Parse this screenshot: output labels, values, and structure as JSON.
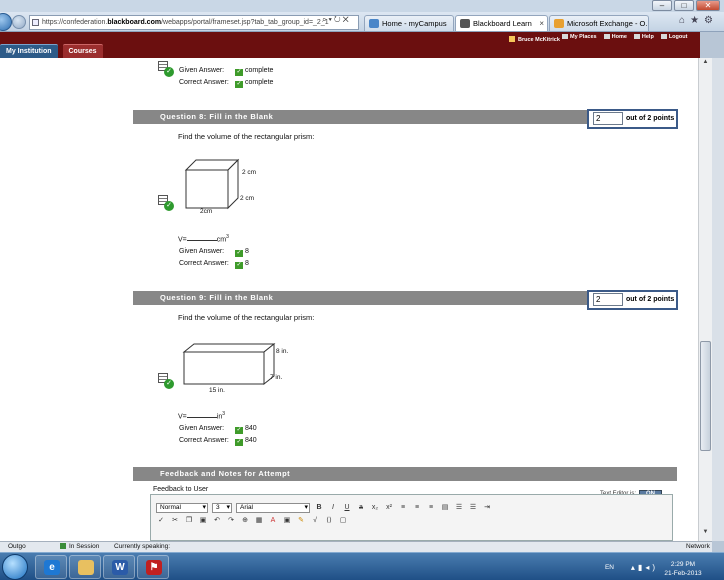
{
  "browser": {
    "url_prefix": "https://confederation.",
    "url_domain": "blackboard.com",
    "url_rest": "/webapps/portal/frameset.jsp?tab_tab_group_id=_2_1",
    "tabs": [
      {
        "label": "Home - myCampus",
        "color": "#4a86c8"
      },
      {
        "label": "Blackboard Learn",
        "color": "#555555"
      },
      {
        "label": "Microsoft Exchange - O...",
        "color": "#e8a030"
      }
    ]
  },
  "bb": {
    "user": "Bruce McKitrick",
    "links": [
      "My Places",
      "Home",
      "Help",
      "Logout"
    ],
    "tabs": [
      "My Institution",
      "Courses"
    ]
  },
  "prev": {
    "given_label": "Given Answer:",
    "given_value": "complete",
    "correct_label": "Correct Answer:",
    "correct_value": "complete"
  },
  "q8": {
    "header": "Question 8:   Fill in the Blank",
    "points_value": "2",
    "points_suffix": "out of 2 points",
    "prompt": "Find the volume of the rectangular prism:",
    "dim_top": "2 cm",
    "dim_side": "2 cm",
    "dim_bottom": "2cm",
    "blank_prefix": "V=",
    "blank_unit": "cm",
    "blank_exp": "3",
    "given_label": "Given Answer:",
    "given_value": "8",
    "correct_label": "Correct Answer:",
    "correct_value": "8"
  },
  "q9": {
    "header": "Question 9:   Fill in the Blank",
    "points_value": "2",
    "points_suffix": "out of 2 points",
    "prompt": "Find the volume of the rectangular prism:",
    "dim_top": "8 in.",
    "dim_side": "7 in.",
    "dim_bottom": "15 in.",
    "blank_prefix": "V=",
    "blank_unit": "in",
    "blank_exp": "3",
    "given_label": "Given Answer:",
    "given_value": "840",
    "correct_label": "Correct Answer:",
    "correct_value": "840"
  },
  "feedback": {
    "header": "Feedback and Notes for Attempt",
    "label": "Feedback to User",
    "text_editor_label": "Text Editor is:",
    "text_editor_state": "ON",
    "format_value": "Normal",
    "size_value": "3",
    "font_value": "Arial"
  },
  "statusbar": {
    "left": "Outgo",
    "in_session": "In Session",
    "speaking": "Currently speaking:",
    "network": "Network"
  },
  "taskbar": {
    "lang": "EN",
    "time": "2:29 PM",
    "date": "21-Feb-2013"
  }
}
